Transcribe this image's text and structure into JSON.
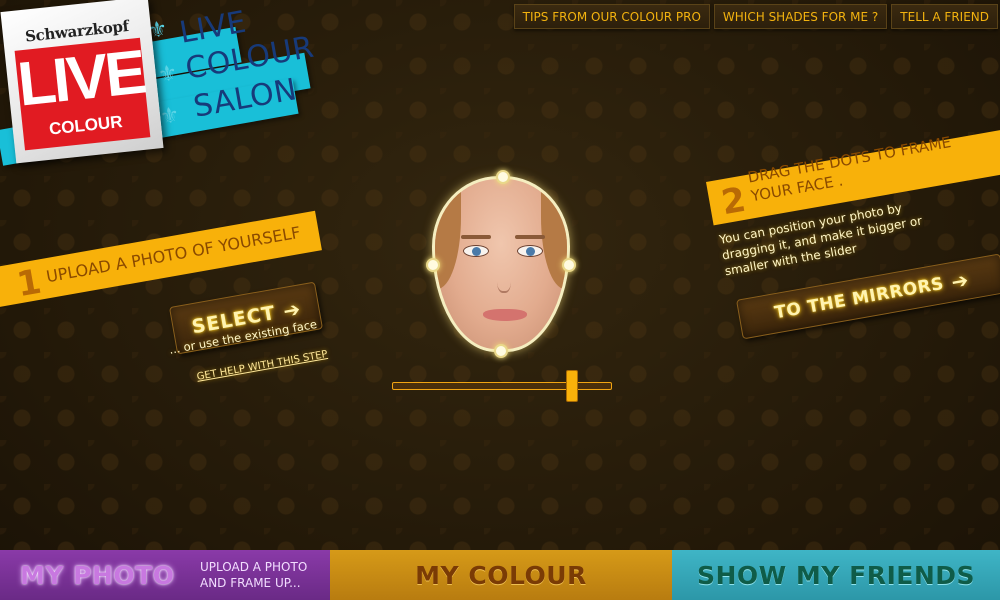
{
  "logo": {
    "brand": "Schwarzkopf",
    "live": "LIVE",
    "colour": "COLOUR"
  },
  "salon": {
    "line1": "LIVE",
    "line2": "COLOUR",
    "line3": "SALON"
  },
  "top_menu": {
    "tips": "TIPS FROM OUR COLOUR PRO",
    "shades": "WHICH SHADES FOR ME ?",
    "friend": "TELL A FRIEND"
  },
  "step1": {
    "number": "1",
    "label": "UPLOAD A PHOTO OF YOURSELF",
    "select_label": "SELECT",
    "or_text": "... or use the existing face",
    "help_link": "GET HELP WITH THIS STEP"
  },
  "step2": {
    "number": "2",
    "label": "DRAG THE DOTS TO FRAME YOUR FACE .",
    "help": "You can position your photo by dragging it, and make it bigger or smaller with the slider",
    "mirrors_label": "TO THE MIRRORS"
  },
  "slider": {
    "value": 0.82
  },
  "bottom_tabs": {
    "my_photo": "MY PHOTO",
    "my_photo_sub": "UPLOAD A PHOTO AND FRAME UP...",
    "my_colour": "MY COLOUR",
    "show_friends": "SHOW MY FRIENDS"
  },
  "colors": {
    "accent_orange": "#f8b10a",
    "salon_cyan": "#19bfd8",
    "logo_red": "#e11b22",
    "tab_photo": "#8a3aa8",
    "tab_colour": "#d69a18",
    "tab_friends": "#3fb5c6"
  },
  "icons": {
    "arrow": "arrow-right-icon",
    "fleur": "fleur-de-lis-icon"
  }
}
